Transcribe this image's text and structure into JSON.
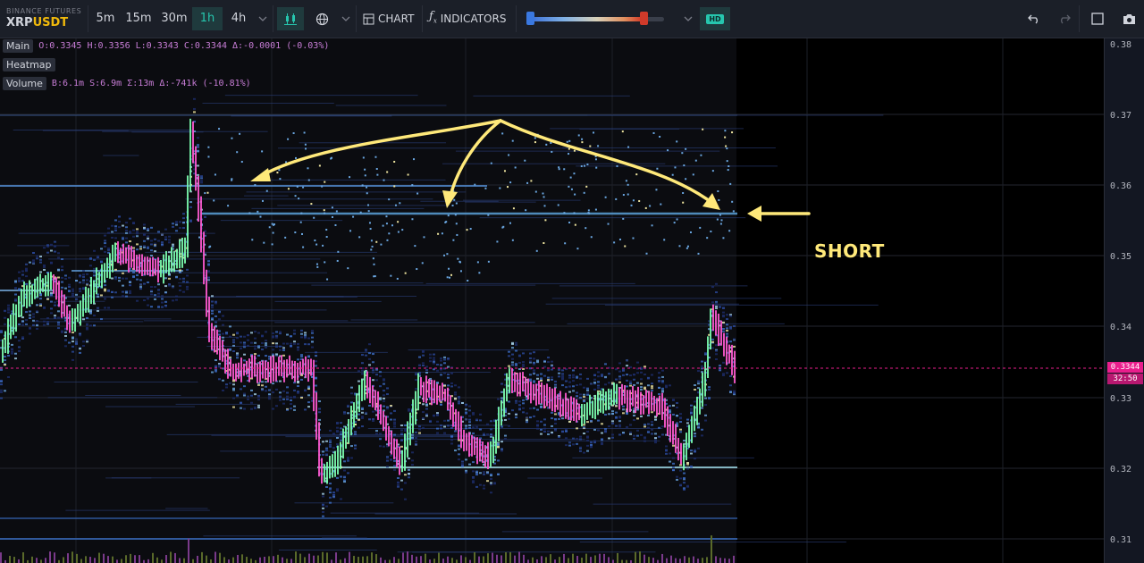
{
  "brand": {
    "exchange": "BINANCE FUTURES",
    "symbol_base": "XRP",
    "symbol_quote": "USDT"
  },
  "timeframes": [
    {
      "label": "5m",
      "active": false
    },
    {
      "label": "15m",
      "active": false
    },
    {
      "label": "30m",
      "active": false
    },
    {
      "label": "1h",
      "active": true
    },
    {
      "label": "4h",
      "active": false
    }
  ],
  "toolbar": {
    "chart_label": "CHART",
    "indicators_label": "INDICATORS",
    "hd_label": "HD"
  },
  "legend": {
    "main": {
      "tag": "Main",
      "values": "O:0.3345 H:0.3356 L:0.3343 C:0.3344 Δ:-0.0001 (-0.03%)"
    },
    "heatmap": {
      "tag": "Heatmap"
    },
    "volume": {
      "tag": "Volume",
      "values": "B:6.1m S:6.9m Σ:13m Δ:-741k (-10.81%)"
    }
  },
  "price_axis": {
    "ticks": [
      "0.38",
      "0.37",
      "0.36",
      "0.35",
      "0.34",
      "0.33",
      "0.32",
      "0.31"
    ],
    "current_price": "0.3344",
    "countdown": "32:50"
  },
  "annotation": {
    "label": "SHORT"
  },
  "colors": {
    "accent": "#26c6ae",
    "price_tag": "#e91e8c",
    "annotation": "#ffe97a",
    "up_candle": "#7dffb0",
    "down_candle": "#ff5ad0"
  }
}
